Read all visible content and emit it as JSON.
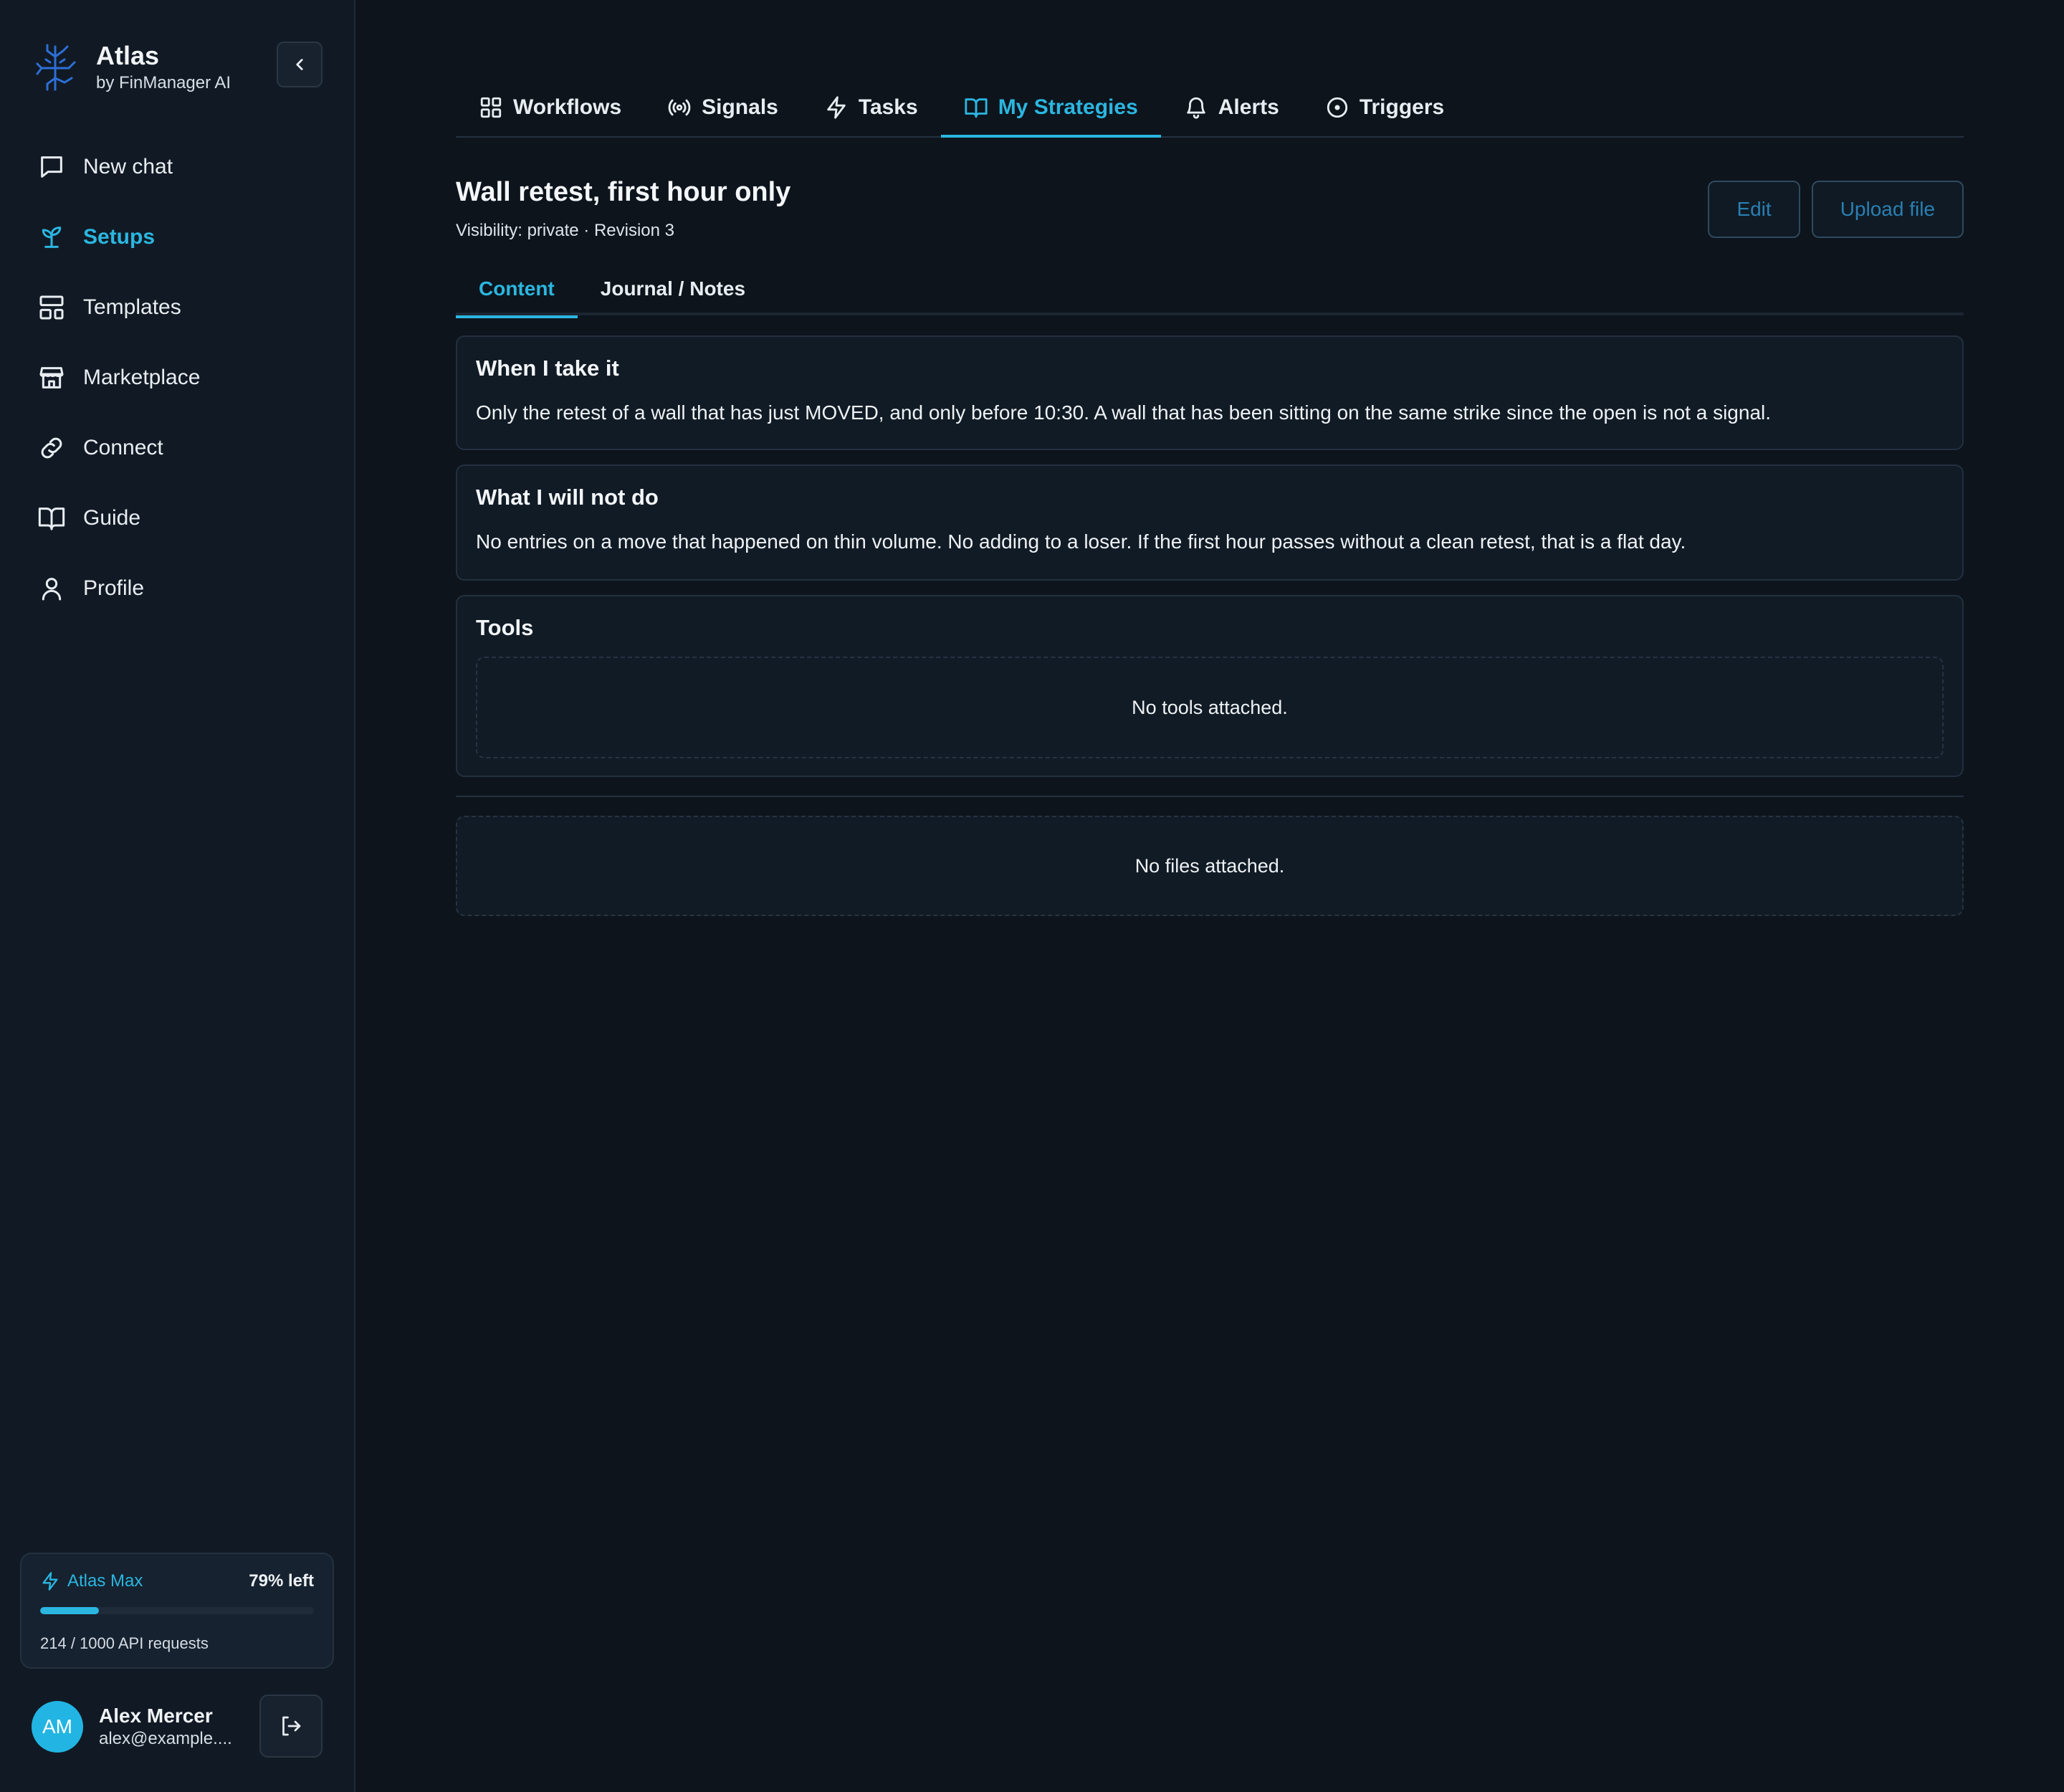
{
  "brand": {
    "title": "Atlas",
    "subtitle": "by FinManager AI"
  },
  "nav": {
    "items": [
      {
        "label": "New chat",
        "icon": "message-square-icon"
      },
      {
        "label": "Setups",
        "icon": "sprout-icon",
        "active": true
      },
      {
        "label": "Templates",
        "icon": "layout-template-icon"
      },
      {
        "label": "Marketplace",
        "icon": "store-icon"
      },
      {
        "label": "Connect",
        "icon": "link-icon"
      },
      {
        "label": "Guide",
        "icon": "book-open-icon"
      },
      {
        "label": "Profile",
        "icon": "user-icon"
      }
    ]
  },
  "plan": {
    "name": "Atlas Max",
    "left": "79% left",
    "usage": "214 / 1000 API requests",
    "used_fraction": 0.214
  },
  "user": {
    "initials": "AM",
    "name": "Alex Mercer",
    "email": "alex@example...."
  },
  "tabs": [
    {
      "label": "Workflows",
      "icon": "grid-icon"
    },
    {
      "label": "Signals",
      "icon": "broadcast-icon"
    },
    {
      "label": "Tasks",
      "icon": "zap-icon"
    },
    {
      "label": "My Strategies",
      "icon": "book-open-icon",
      "active": true
    },
    {
      "label": "Alerts",
      "icon": "bell-icon"
    },
    {
      "label": "Triggers",
      "icon": "circle-dot-icon"
    }
  ],
  "strategy": {
    "title": "Wall retest, first hour only",
    "meta": "Visibility: private · Revision 3",
    "edit_label": "Edit",
    "upload_label": "Upload file"
  },
  "subtabs": {
    "content": "Content",
    "journal": "Journal / Notes"
  },
  "sections": {
    "when": {
      "title": "When I take it",
      "body": "Only the retest of a wall that has just MOVED, and only before 10:30. A wall that has been sitting on the same strike since the open is not a signal."
    },
    "not": {
      "title": "What I will not do",
      "body": "No entries on a move that happened on thin volume. No adding to a loser. If the first hour passes without a clean retest, that is a flat day."
    },
    "tools": {
      "title": "Tools",
      "empty": "No tools attached."
    }
  },
  "files": {
    "empty": "No files attached."
  },
  "colors": {
    "accent": "#2bb6e0",
    "background": "#0d141c",
    "sidebar": "#111a24",
    "logo": "#2d6fd6"
  }
}
